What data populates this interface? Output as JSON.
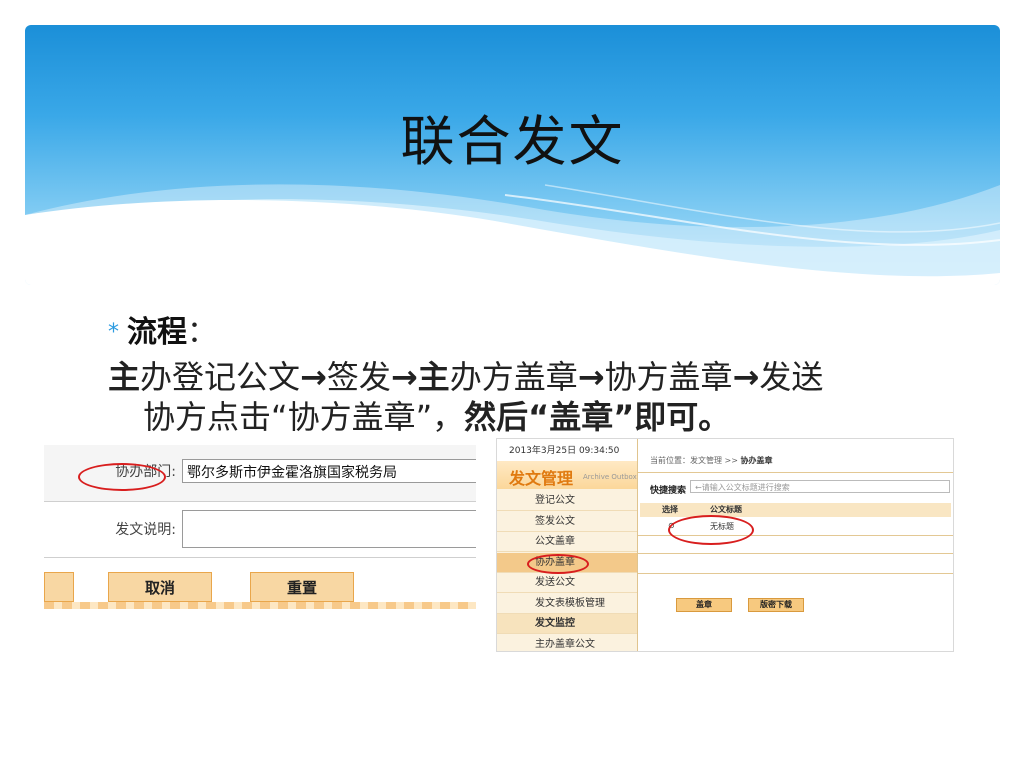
{
  "slide": {
    "title": "联合发文",
    "bullet_marker": "*",
    "bullet_strong": "流程",
    "bullet_colon": "：",
    "steps_line1": [
      {
        "text": "主",
        "bold": true
      },
      {
        "text": "办登记公文",
        "bold": false
      },
      {
        "text": "→",
        "bold": true
      },
      {
        "text": "签发",
        "bold": false
      },
      {
        "text": "→",
        "bold": true
      },
      {
        "text": "主",
        "bold": true
      },
      {
        "text": "办方盖章",
        "bold": false
      },
      {
        "text": "→",
        "bold": true
      },
      {
        "text": "协方盖章",
        "bold": false
      },
      {
        "text": "→",
        "bold": true
      },
      {
        "text": "发送",
        "bold": false
      }
    ],
    "steps_line2_normal": "协方点击“协方盖章”，",
    "steps_line2_bold1": "然后“",
    "steps_line2_bold2": "盖章",
    "steps_line2_bold3": "”即可。"
  },
  "form_shot": {
    "dept_label": "协办部门:",
    "dept_value": "鄂尔多斯市伊金霍洛旗国家税务局",
    "desc_label": "发文说明:",
    "desc_value": "",
    "cancel_label": "取消",
    "reset_label": "重置"
  },
  "sys_shot": {
    "datetime": "2013年3月25日 09:34:50",
    "module_title": "发文管理",
    "module_subtitle": "Archive Outbox",
    "menu": [
      {
        "label": "登记公文",
        "active": false,
        "group": false
      },
      {
        "label": "签发公文",
        "active": false,
        "group": false
      },
      {
        "label": "公文盖章",
        "active": false,
        "group": false
      },
      {
        "label": "协办盖章",
        "active": true,
        "group": false
      },
      {
        "label": "发送公文",
        "active": false,
        "group": false
      },
      {
        "label": "发文表模板管理",
        "active": false,
        "group": false
      },
      {
        "label": "发文监控",
        "active": false,
        "group": true
      },
      {
        "label": "主办盖章公文",
        "active": false,
        "group": false
      }
    ],
    "breadcrumb_prefix": "当前位置：发文管理 >> ",
    "breadcrumb_current": "协办盖章",
    "quick_search_label": "快捷搜索",
    "search_placeholder": "←请输入公文标题进行搜索",
    "col_select": "选择",
    "col_title": "公文标题",
    "row_radio": "⊙",
    "row_title": "无标题",
    "seal_button": "盖章",
    "download_button": "版密下载"
  },
  "colors": {
    "header_top": "#1b8fd8",
    "header_bottom": "#b7e3fb",
    "bullet_star": "#2c9be0",
    "highlight_ellipse": "#d81e1e",
    "button_fill": "#f8d7a3"
  }
}
